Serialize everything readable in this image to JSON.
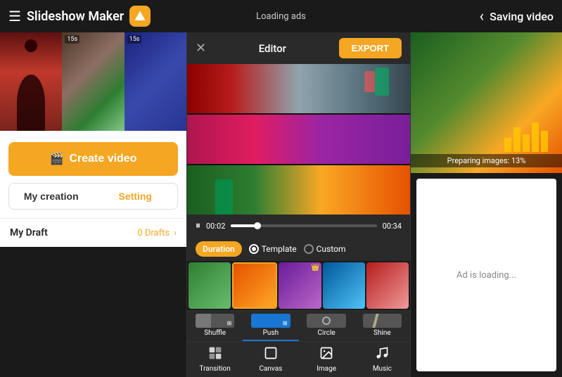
{
  "app": {
    "title": "Slideshow Maker",
    "loading_ads": "Loading ads",
    "saving_title": "Saving video"
  },
  "left_panel": {
    "create_video_label": "Create video",
    "my_creation_label": "My creation",
    "setting_label": "Setting",
    "my_draft_label": "My Draft",
    "draft_count": "0 Drafts"
  },
  "editor": {
    "title": "Editor",
    "export_label": "EXPORT",
    "time_current": "00:02",
    "time_total": "00:34",
    "duration_label": "Duration",
    "template_label": "Template",
    "custom_label": "Custom",
    "transitions": [
      "Shuffle",
      "Push",
      "Circle",
      "Shine"
    ],
    "toolbar_items": [
      "Transition",
      "Canvas",
      "Image",
      "Music"
    ]
  },
  "saving": {
    "preparing_text": "Preparing images: 13%",
    "ad_loading": "Ad is loading..."
  },
  "icons": {
    "hamburger": "☰",
    "close": "✕",
    "play": "⏸",
    "back": "‹",
    "film": "🎬",
    "chevron_right": "›",
    "crown": "👑",
    "transition": "⊞",
    "canvas": "⬜",
    "image": "🖼",
    "music": "♫"
  }
}
